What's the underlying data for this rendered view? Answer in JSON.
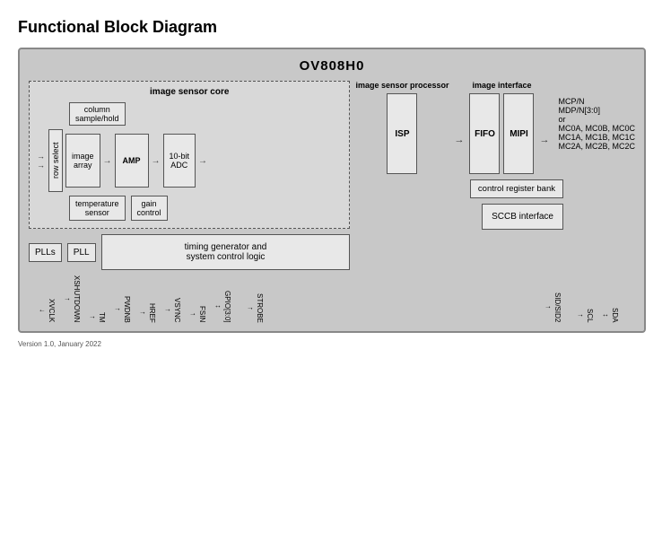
{
  "title": "Functional Block Diagram",
  "chip": {
    "name": "OV808H0"
  },
  "sections": {
    "image_sensor_core": "image sensor core",
    "image_sensor_processor": "image sensor processor",
    "image_interface": "image interface"
  },
  "blocks": {
    "column_sample_hold": "column\nsample/hold",
    "row_select": "row select",
    "image_array": "image\narray",
    "amp": "AMP",
    "adc": "10-bit\nADC",
    "isp": "ISP",
    "fifo": "FIFO",
    "mipi": "MIPI",
    "temperature_sensor": "temperature\nsensor",
    "gain_control": "gain\ncontrol",
    "control_register_bank": "control register bank",
    "plls": "PLLs",
    "pll": "PLL",
    "timing_generator": "timing generator and\nsystem control logic",
    "sccb_interface": "SCCB interface"
  },
  "external_signals": {
    "right": [
      "MCP/N",
      "MDP/N[3:0]",
      "or",
      "MC0A, MC0B, MC0C",
      "MC1A, MC1B, MC1C",
      "MC2A, MC2B, MC2C"
    ],
    "bottom": [
      "XVCLK",
      "XSHUTDOWN",
      "TM",
      "PWDNB",
      "HREF",
      "VSYNC",
      "FSIN",
      "GPIO[3:0]",
      "STROBE",
      "SID/SID2",
      "SCL",
      "SDA"
    ]
  },
  "version": "Version 1.0, January 2022"
}
